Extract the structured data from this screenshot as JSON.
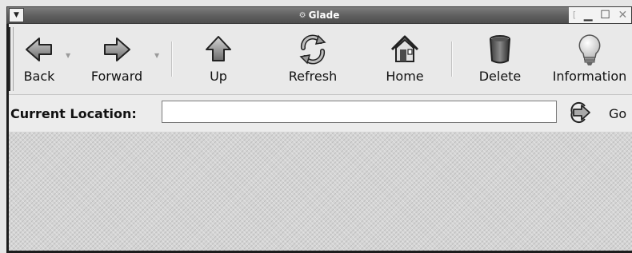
{
  "window": {
    "title": "Glade"
  },
  "toolbar": {
    "back": "Back",
    "forward": "Forward",
    "up": "Up",
    "refresh": "Refresh",
    "home": "Home",
    "delete": "Delete",
    "information": "Information"
  },
  "location": {
    "label": "Current Location:",
    "value": "",
    "go": "Go"
  },
  "icons": {
    "back": "left-arrow-icon",
    "forward": "right-arrow-icon",
    "up": "up-arrow-icon",
    "refresh": "refresh-icon",
    "home": "home-icon",
    "delete": "trash-can-icon",
    "information": "light-bulb-icon",
    "go": "go-arrow-icon"
  }
}
